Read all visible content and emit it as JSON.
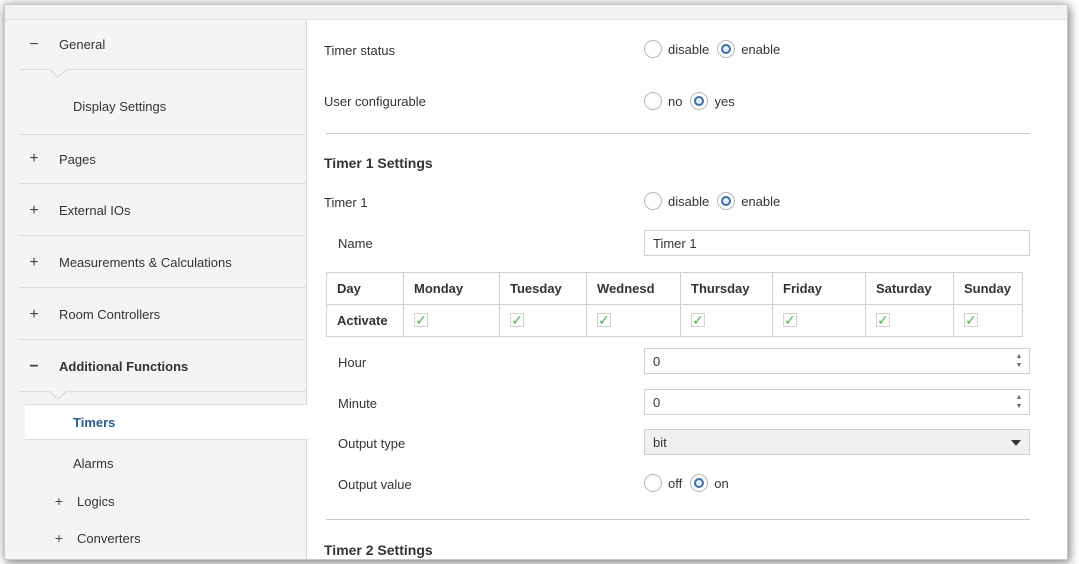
{
  "sidebar": {
    "items": [
      {
        "sign": "−",
        "label": "General"
      },
      {
        "label": "Display Settings"
      },
      {
        "sign": "+",
        "label": "Pages"
      },
      {
        "sign": "+",
        "label": "External IOs"
      },
      {
        "sign": "+",
        "label": "Measurements & Calculations"
      },
      {
        "sign": "+",
        "label": "Room Controllers"
      },
      {
        "sign": "−",
        "label": "Additional Functions"
      },
      {
        "label": "Timers"
      },
      {
        "label": "Alarms"
      },
      {
        "sign": "+",
        "label": "Logics"
      },
      {
        "sign": "+",
        "label": "Converters"
      }
    ]
  },
  "main": {
    "timer_status": {
      "label": "Timer status",
      "opt1": "disable",
      "opt2": "enable",
      "selected": "enable"
    },
    "user_configurable": {
      "label": "User configurable",
      "opt1": "no",
      "opt2": "yes",
      "selected": "yes"
    },
    "timer1_section": "Timer 1 Settings",
    "timer1": {
      "label": "Timer 1",
      "opt1": "disable",
      "opt2": "enable",
      "selected": "enable"
    },
    "name": {
      "label": "Name",
      "value": "Timer 1"
    },
    "days_table": {
      "header_first": "Day",
      "days": [
        "Monday",
        "Tuesday",
        "Wednesd",
        "Thursday",
        "Friday",
        "Saturday",
        "Sunday"
      ],
      "row_label": "Activate",
      "check_glyph": "✓",
      "activated": [
        true,
        true,
        true,
        true,
        true,
        true,
        true
      ]
    },
    "hour": {
      "label": "Hour",
      "value": "0"
    },
    "minute": {
      "label": "Minute",
      "value": "0"
    },
    "output_type": {
      "label": "Output type",
      "value": "bit"
    },
    "output_value": {
      "label": "Output value",
      "opt1": "off",
      "opt2": "on",
      "selected": "on"
    },
    "timer2_section": "Timer 2 Settings"
  },
  "colors": {
    "accent": "#3a6fb0",
    "selected_text": "#2a5c8f",
    "check": "#4caf50"
  }
}
